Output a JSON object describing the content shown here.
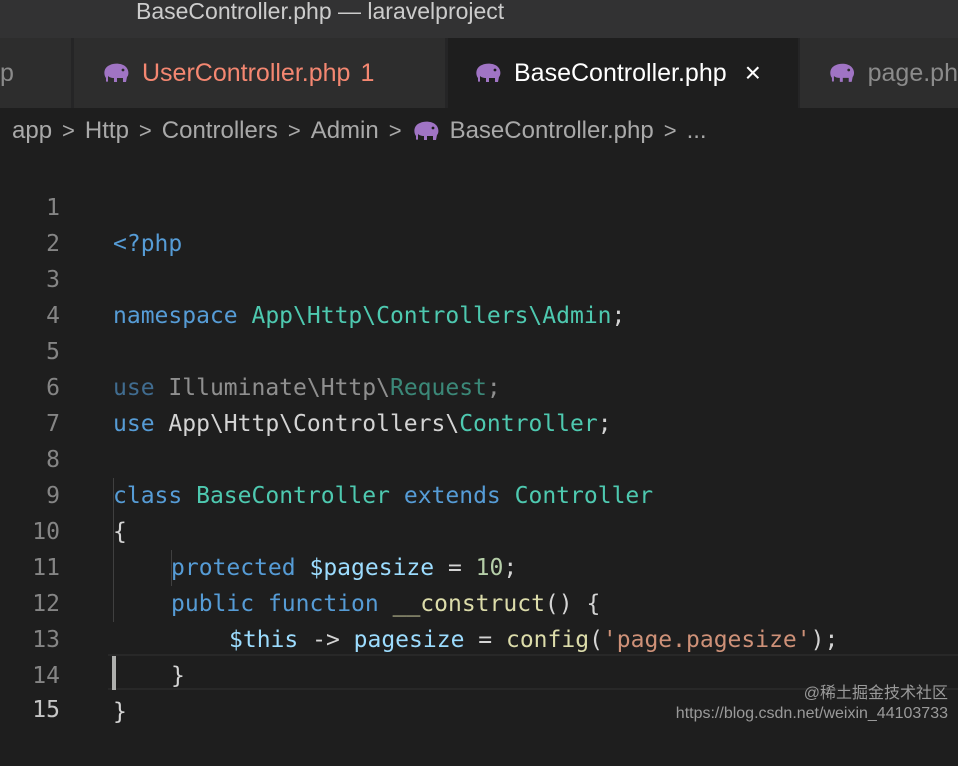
{
  "window": {
    "title": "BaseController.php — laravelproject"
  },
  "tabs": [
    {
      "label": "p"
    },
    {
      "label": "UserController.php",
      "badge": "1"
    },
    {
      "label": "BaseController.php",
      "close": "×"
    },
    {
      "label": "page.ph"
    }
  ],
  "breadcrumb": [
    "app",
    "Http",
    "Controllers",
    "Admin",
    "BaseController.php",
    "..."
  ],
  "breadcrumb_sep": ">",
  "code": {
    "line_numbers": [
      "1",
      "2",
      "3",
      "4",
      "5",
      "6",
      "7",
      "8",
      "9",
      "10",
      "11",
      "12",
      "13",
      "14",
      "15"
    ],
    "l1": "<?php",
    "l3_kw": "namespace",
    "l3_ns": "App\\Http\\Controllers\\Admin",
    "l3_end": ";",
    "l5_kw": "use",
    "l5_ns": "Illuminate\\Http\\",
    "l5_cls": "Request",
    "l5_end": ";",
    "l6_kw": "use",
    "l6_ns": "App\\Http\\Controllers\\",
    "l6_cls": "Controller",
    "l6_end": ";",
    "l8_kw": "class",
    "l8_cls": "BaseController",
    "l8_ext": "extends",
    "l8_parent": "Controller",
    "l9": "{",
    "l10_kw": "protected",
    "l10_var": "$pagesize",
    "l10_eq": " = ",
    "l10_num": "10",
    "l10_end": ";",
    "l11_kw1": "public",
    "l11_kw2": "function",
    "l11_fn": "__construct",
    "l11_end": "() {",
    "l12_this": "$this",
    "l12_arrow": " -> ",
    "l12_prop": "pagesize",
    "l12_eq": " = ",
    "l12_call": "config",
    "l12_open": "(",
    "l12_str": "'page.pagesize'",
    "l12_close": ");",
    "l13": "}",
    "l14": "}"
  },
  "watermark": {
    "line1": "@稀土掘金技术社区",
    "line2": "https://blog.csdn.net/weixin_44103733"
  },
  "colors": {
    "editor_bg": "#1e1e1e",
    "tab_error": "#f48771",
    "php_icon": "#a074c4",
    "keyword": "#569cd6",
    "type": "#4ec9b0",
    "string": "#ce9178"
  },
  "icons": {
    "tab_file": "php-elephant-icon",
    "close": "close-icon"
  }
}
